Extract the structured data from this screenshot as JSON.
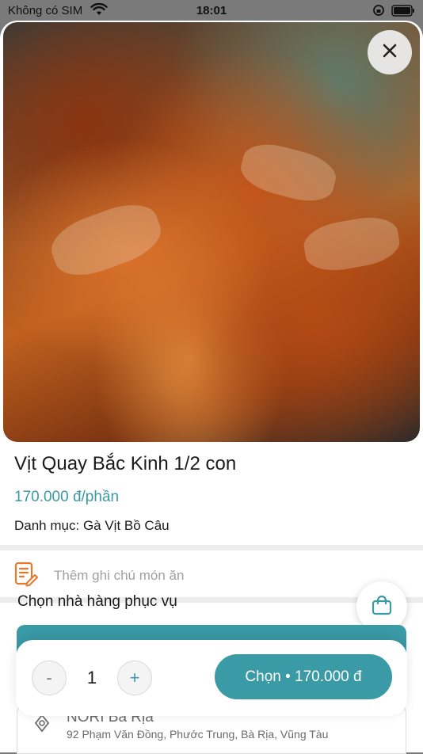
{
  "status_bar": {
    "carrier": "Không có SIM",
    "time": "18:01"
  },
  "product": {
    "name": "Vịt Quay Bắc Kinh 1/2 con",
    "price": "170.000 đ/phần",
    "category_label": "Danh mục: ",
    "category_value": "Gà Vịt Bồ Câu"
  },
  "note": {
    "placeholder": "Thêm ghi chú món ăn"
  },
  "restaurants": {
    "section_title": "Chọn nhà hàng phục vụ",
    "items": [
      {
        "name": "NORI Bà Rịa",
        "address": "92 Phạm Văn Đồng, Phước Trung, Bà Rịa, Vũng Tàu"
      }
    ]
  },
  "order_bar": {
    "minus_label": "-",
    "quantity": "1",
    "plus_label": "+",
    "select_label": "Chọn • 170.000 đ"
  },
  "colors": {
    "accent": "#3a9aa6",
    "note_icon": "#e57a2c"
  }
}
